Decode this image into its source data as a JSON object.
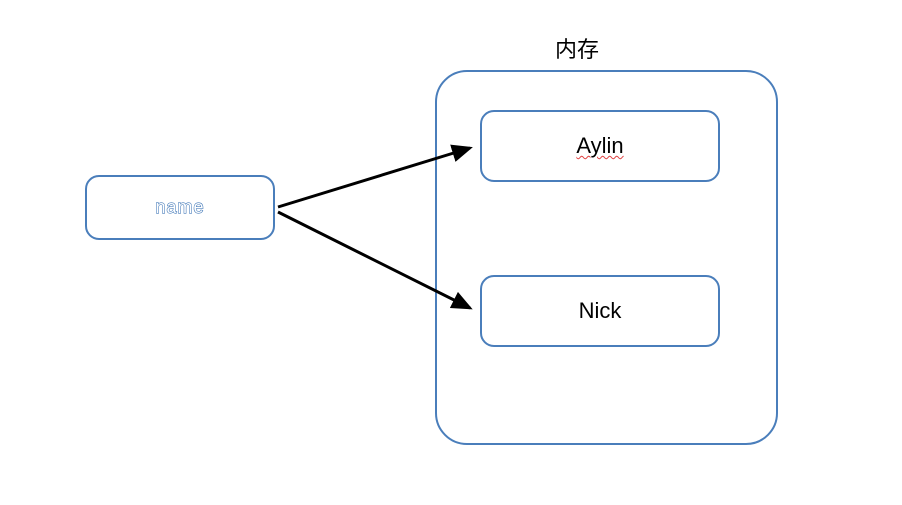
{
  "variable": {
    "label": "name"
  },
  "memory": {
    "title": "内存",
    "objects": [
      {
        "label": "Aylin",
        "spellcheck": true
      },
      {
        "label": "Nick",
        "spellcheck": false
      }
    ]
  },
  "arrows": [
    {
      "from": "variable",
      "to": "object-0"
    },
    {
      "from": "variable",
      "to": "object-1"
    }
  ]
}
